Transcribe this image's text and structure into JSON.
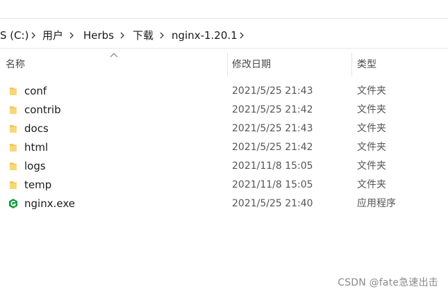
{
  "breadcrumb": {
    "items": [
      "S (C:)",
      "用户",
      "Herbs",
      "下载",
      "nginx-1.20.1"
    ]
  },
  "columns": {
    "name": "名称",
    "date": "修改日期",
    "type": "类型"
  },
  "files": [
    {
      "name": "conf",
      "date": "2021/5/25 21:43",
      "type": "文件夹",
      "icon": "folder-icon"
    },
    {
      "name": "contrib",
      "date": "2021/5/25 21:42",
      "type": "文件夹",
      "icon": "folder-icon"
    },
    {
      "name": "docs",
      "date": "2021/5/25 21:43",
      "type": "文件夹",
      "icon": "folder-icon"
    },
    {
      "name": "html",
      "date": "2021/5/25 21:42",
      "type": "文件夹",
      "icon": "folder-icon"
    },
    {
      "name": "logs",
      "date": "2021/11/8 15:05",
      "type": "文件夹",
      "icon": "folder-icon"
    },
    {
      "name": "temp",
      "date": "2021/11/8 15:05",
      "type": "文件夹",
      "icon": "folder-icon"
    },
    {
      "name": "nginx.exe",
      "date": "2021/5/25 21:40",
      "type": "应用程序",
      "icon": "nginx-app-icon"
    }
  ],
  "watermark": "CSDN @fate急速出击",
  "colors": {
    "folder": "#f2c75c",
    "nginx_green": "#0b9a3a"
  }
}
